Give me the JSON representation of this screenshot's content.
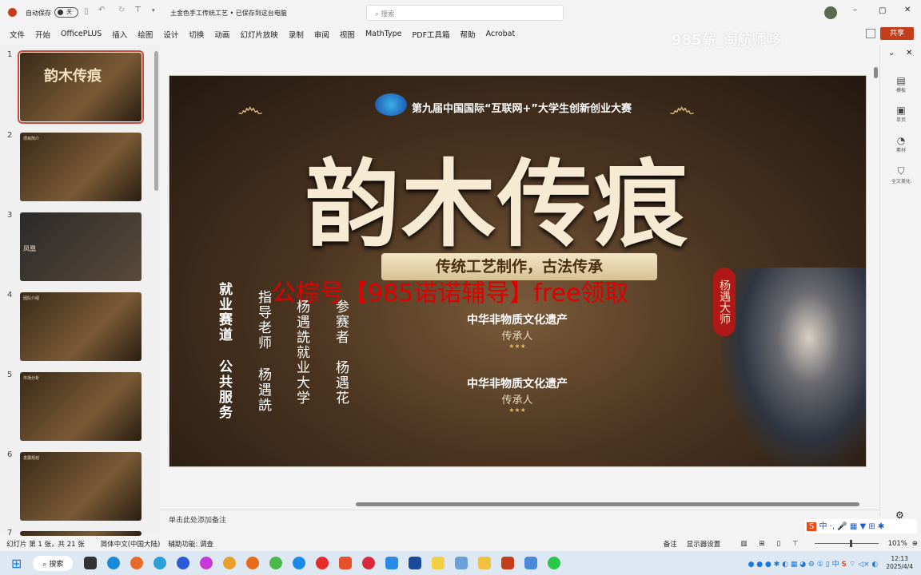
{
  "titlebar": {
    "autosave_label": "自动保存",
    "autosave_state": "关",
    "doc_title": "土金色手工传统工艺 • 已保存到这台电脑",
    "search_placeholder": "搜索"
  },
  "menu": [
    "文件",
    "开始",
    "OfficePLUS",
    "插入",
    "绘图",
    "设计",
    "切换",
    "动画",
    "幻灯片放映",
    "录制",
    "审阅",
    "视图",
    "MathType",
    "PDF工具箱",
    "帮助",
    "Acrobat"
  ],
  "watermark_top": "985薪_海航师哆",
  "share_label": "共享",
  "thumbnails": [
    {
      "num": "1",
      "title": "韵木传痕",
      "selected": true
    },
    {
      "num": "2",
      "title": "项目简介"
    },
    {
      "num": "3",
      "title": "凤凰"
    },
    {
      "num": "4",
      "title": "团队介绍"
    },
    {
      "num": "5",
      "title": "市场分析"
    },
    {
      "num": "6",
      "title": "发展规划"
    },
    {
      "num": "7",
      "title": ""
    }
  ],
  "slide": {
    "competition": "第九届中国国际“互联网+”大学生创新创业大赛",
    "main_title": "韵木传痕",
    "subtitle": "传统工艺制作，古法传承",
    "overlay": "公棕号【985诺诺辅导】free领取",
    "columns": [
      {
        "label": "就业赛道",
        "value": "公共服务"
      },
      {
        "label": "指导老师",
        "value": "杨遇詵"
      },
      {
        "label": "杨遇詵就业大学",
        "value": ""
      },
      {
        "label": "参赛者",
        "value": "杨遇花"
      }
    ],
    "badge": "杨遇大师",
    "awards": [
      {
        "title": "中华非物质文化遗产",
        "sub": "传承人",
        "stars": "★★★"
      },
      {
        "title": "中华非物质文化遗产",
        "sub": "传承人",
        "stars": "★★★"
      }
    ]
  },
  "right_pane": [
    {
      "label": "模板",
      "icon": "template-icon"
    },
    {
      "label": "单页",
      "icon": "page-icon"
    },
    {
      "label": "素材",
      "icon": "clock-icon"
    },
    {
      "label": "全文美化",
      "icon": "shirt-icon"
    }
  ],
  "notes_placeholder": "单击此处添加备注",
  "status": {
    "slide_info": "幻灯片 第 1 张，共 21 张",
    "language": "简体中文(中国大陆)",
    "accessibility": "辅助功能: 调查",
    "notes": "备注",
    "display": "显示器设置",
    "zoom": "101%",
    "zoom_value": 101
  },
  "taskbar": {
    "search": "搜索",
    "time": "12:13",
    "date": "2025/4/4"
  }
}
